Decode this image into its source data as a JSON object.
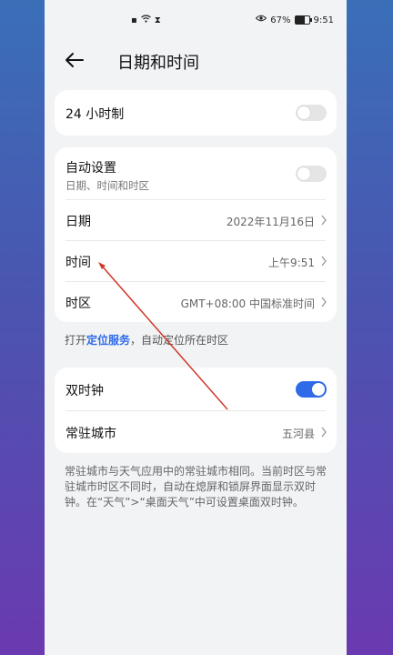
{
  "status": {
    "battery": "67%",
    "battery_level": 0.67,
    "time": "9:51",
    "icons": [
      "notification-icon",
      "wifi-icon",
      "hourglass-icon",
      "eye-icon",
      "battery-icon"
    ]
  },
  "header": {
    "title": "日期和时间"
  },
  "card1": {
    "label_24h": "24 小时制",
    "toggle_24h": false
  },
  "card2": {
    "auto_label": "自动设置",
    "auto_sub": "日期、时间和时区",
    "auto_toggle": false,
    "date_label": "日期",
    "date_value": "2022年11月16日",
    "time_label": "时间",
    "time_value": "上午9:51",
    "tz_label": "时区",
    "tz_value": "GMT+08:00 中国标准时间"
  },
  "hint": {
    "prefix": "打开",
    "link": "定位服务",
    "suffix": "，自动定位所在时区"
  },
  "card3": {
    "dual_label": "双时钟",
    "dual_toggle": true,
    "city_label": "常驻城市",
    "city_value": "五河县"
  },
  "note": "常驻城市与天气应用中的常驻城市相同。当前时区与常驻城市时区不同时，自动在熄屏和锁屏界面显示双时钟。在“天气”>“桌面天气”中可设置桌面双时钟。",
  "colors": {
    "accent": "#2f6be8",
    "annotation_arrow": "#d03a2a",
    "page_bg": "#f1f3f5"
  }
}
